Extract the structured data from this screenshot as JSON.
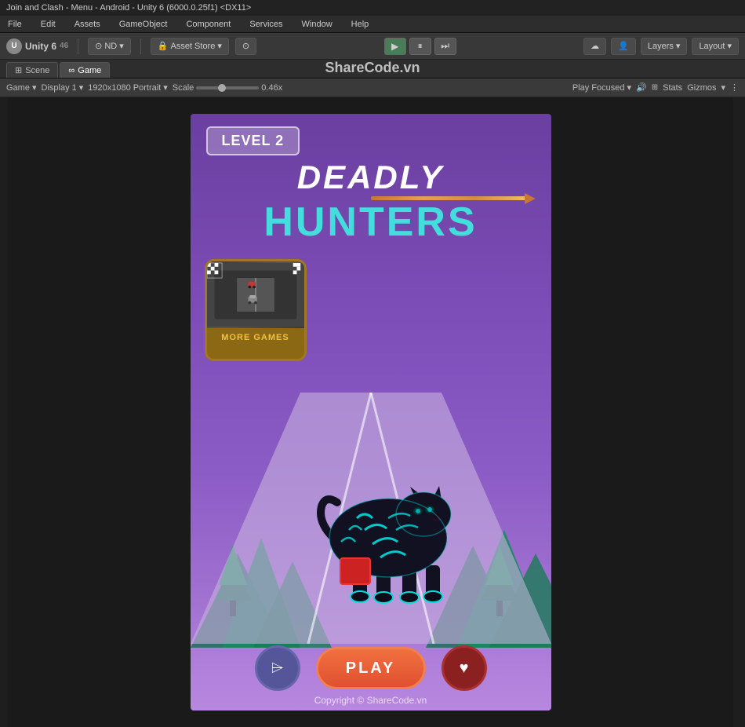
{
  "window": {
    "title": "Join and Clash - Menu - Android - Unity 6 (6000.0.25f1) <DX11>"
  },
  "menu": {
    "items": [
      "File",
      "Edit",
      "Assets",
      "GameObject",
      "Component",
      "Services",
      "Window",
      "Help"
    ]
  },
  "toolbar": {
    "unity_label": "Unity 6",
    "nd_label": "ND",
    "asset_store_label": "Asset Store",
    "play_label": "▶",
    "pause_label": "⏸",
    "step_label": "⏭"
  },
  "tabs": {
    "scene_label": "Scene",
    "game_label": "Game"
  },
  "game_toolbar": {
    "game_label": "Game",
    "display_label": "Display 1",
    "resolution_label": "1920x1080 Portrait",
    "scale_label": "Scale",
    "scale_value": "0.46x",
    "play_focused_label": "Play Focused",
    "stats_label": "Stats",
    "gizmos_label": "Gizmos"
  },
  "game_content": {
    "level_label": "LEVEL 2",
    "deadly_text": "DEADLY",
    "hunters_text": "HUNTERS",
    "more_games_label": "MORE GAMES",
    "play_button_label": "PLAY",
    "copyright_text": "Copyright © ShareCode.vn",
    "sharecode_watermark": "ShareCode.vn"
  }
}
